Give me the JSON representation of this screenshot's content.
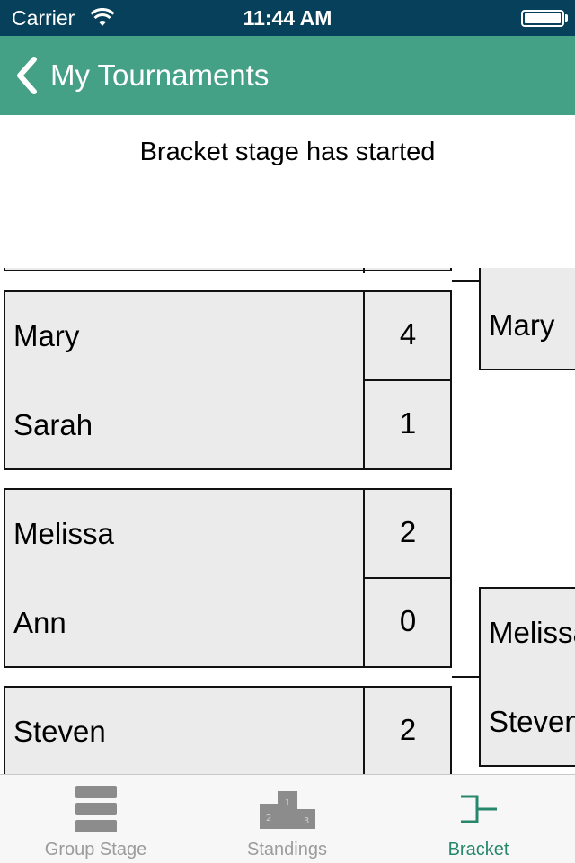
{
  "status_bar": {
    "carrier": "Carrier",
    "time": "11:44 AM"
  },
  "nav": {
    "back_label": "My Tournaments"
  },
  "message": "Bracket stage has started",
  "bracket": {
    "round1": [
      {
        "player1": "Mary",
        "score1": "4",
        "player2": "Sarah",
        "score2": "1"
      },
      {
        "player1": "Melissa",
        "score1": "2",
        "player2": "Ann",
        "score2": "0"
      },
      {
        "player1": "Steven",
        "score1": "2"
      }
    ],
    "round2": [
      {
        "player1": "Mary"
      },
      {
        "player1": "Melissa",
        "player2": "Steven"
      }
    ]
  },
  "tabs": [
    {
      "label": "Group Stage",
      "icon": "group-stage-icon"
    },
    {
      "label": "Standings",
      "icon": "podium-icon"
    },
    {
      "label": "Bracket",
      "icon": "bracket-icon",
      "active": true
    }
  ],
  "colors": {
    "status_bar_bg": "#07405a",
    "nav_bg": "#45a186",
    "active_tab": "#27876a",
    "inactive_tab": "#9b9b9b",
    "match_bg": "#ebebeb"
  }
}
